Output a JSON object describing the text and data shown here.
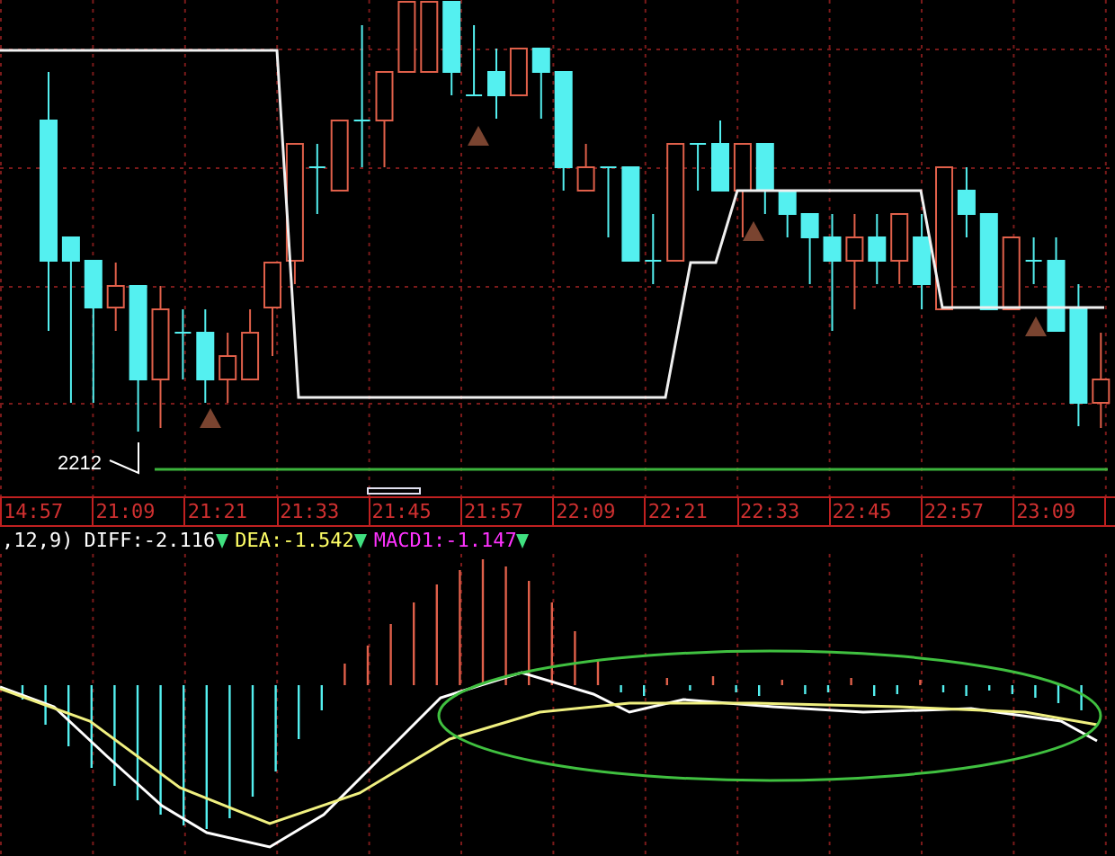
{
  "price_chart": {
    "price_label": "2212"
  },
  "time_axis": {
    "labels": [
      "14:57",
      "21:09",
      "21:21",
      "21:33",
      "21:45",
      "21:57",
      "22:09",
      "22:21",
      "22:33",
      "22:45",
      "22:57",
      "23:09"
    ]
  },
  "macd": {
    "legend_prefix": ",12,9)",
    "items": [
      {
        "label": "DIFF:-2.116",
        "color": "#ffffff"
      },
      {
        "label": "DEA:-1.542",
        "color": "#ffff66"
      },
      {
        "label": "MACD1:-1.147",
        "color": "#ff33ff"
      }
    ]
  }
}
